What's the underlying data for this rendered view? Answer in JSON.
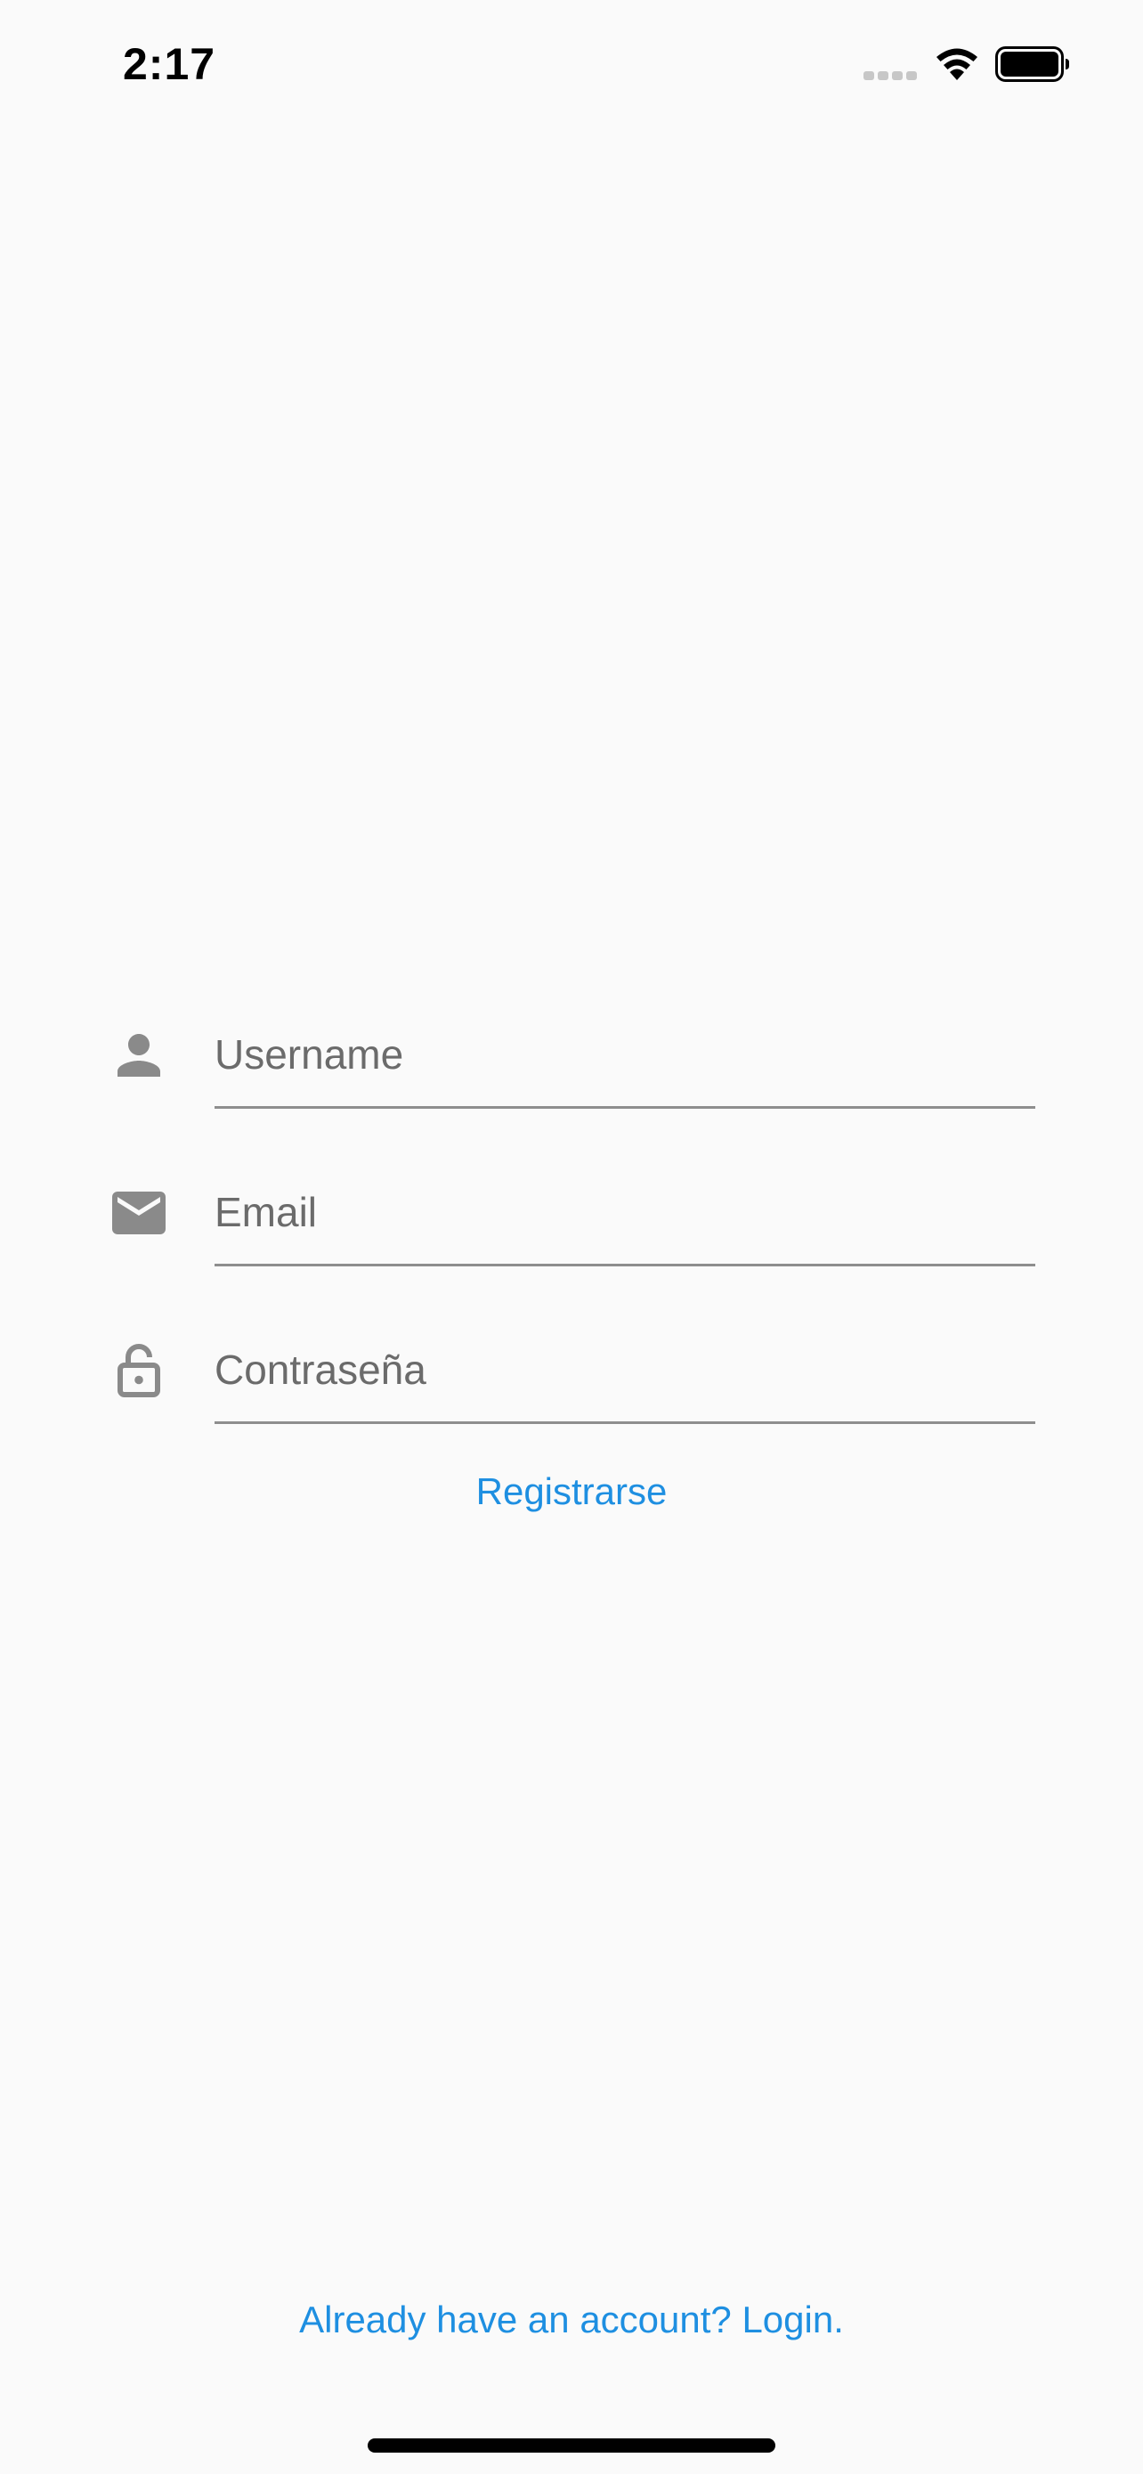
{
  "status_bar": {
    "time": "2:17",
    "icons": [
      "cellular-signal-icon",
      "wifi-icon",
      "battery-icon"
    ]
  },
  "form": {
    "username": {
      "placeholder": "Username",
      "value": "",
      "icon": "person-icon"
    },
    "email": {
      "placeholder": "Email",
      "value": "",
      "icon": "mail-icon"
    },
    "password": {
      "placeholder": "Contraseña",
      "value": "",
      "icon": "lock-icon"
    },
    "submit_label": "Registrarse"
  },
  "footer": {
    "login_link": "Already have an account? Login."
  },
  "colors": {
    "background": "#fafafa",
    "accent": "#1e8fe1",
    "icon": "#8a8a8a",
    "underline": "#8e8e8e"
  }
}
